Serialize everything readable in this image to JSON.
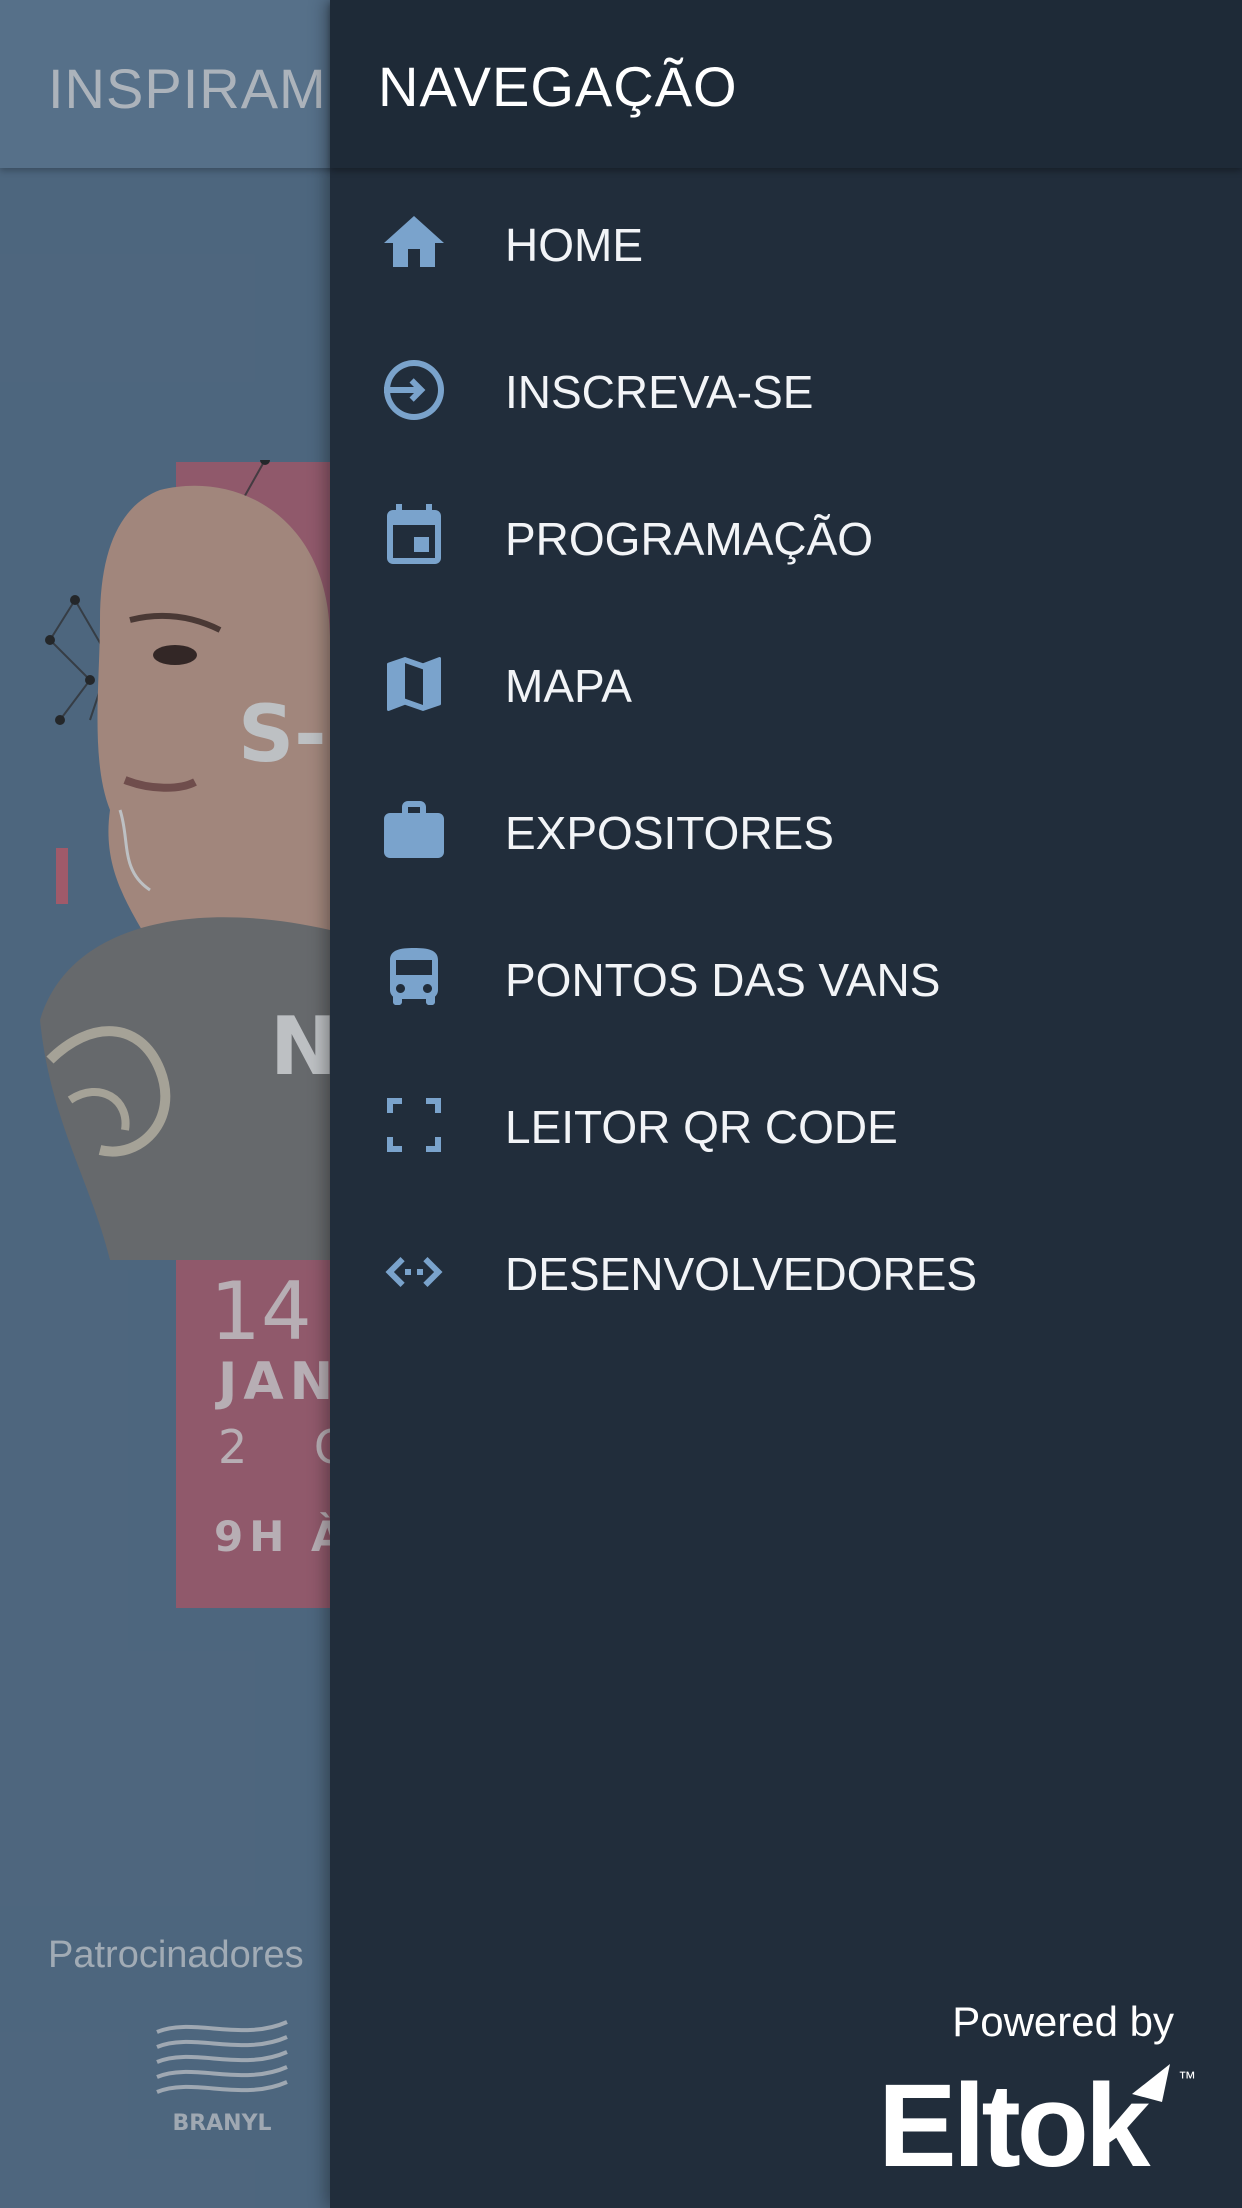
{
  "background": {
    "appbar_title": "INSPIRAM",
    "poster": {
      "lines": [
        "14 -",
        "JAN",
        "2 O",
        "9H À"
      ],
      "fragment_s": "S-",
      "fragment_n": "N"
    },
    "sponsors_label": "Patrocinadores",
    "sponsor_logo_text": "BRANYL"
  },
  "drawer": {
    "title": "NAVEGAÇÃO",
    "items": [
      {
        "label": "HOME",
        "icon": "home-icon"
      },
      {
        "label": "INSCREVA-SE",
        "icon": "login-icon"
      },
      {
        "label": "PROGRAMAÇÃO",
        "icon": "calendar-icon"
      },
      {
        "label": "MAPA",
        "icon": "map-icon"
      },
      {
        "label": "EXPOSITORES",
        "icon": "briefcase-icon"
      },
      {
        "label": "PONTOS DAS VANS",
        "icon": "bus-icon"
      },
      {
        "label": "LEITOR QR CODE",
        "icon": "qr-scan-icon"
      },
      {
        "label": "DESENVOLVEDORES",
        "icon": "developer-icon"
      }
    ],
    "footer": {
      "powered_by": "Powered by",
      "brand": "Eltok",
      "trademark": "™"
    }
  },
  "colors": {
    "drawer_bg": "#212d3b",
    "icon_accent": "#7aa3cc",
    "text": "#f2f4f7",
    "poster_pink": "#b46a7d"
  }
}
